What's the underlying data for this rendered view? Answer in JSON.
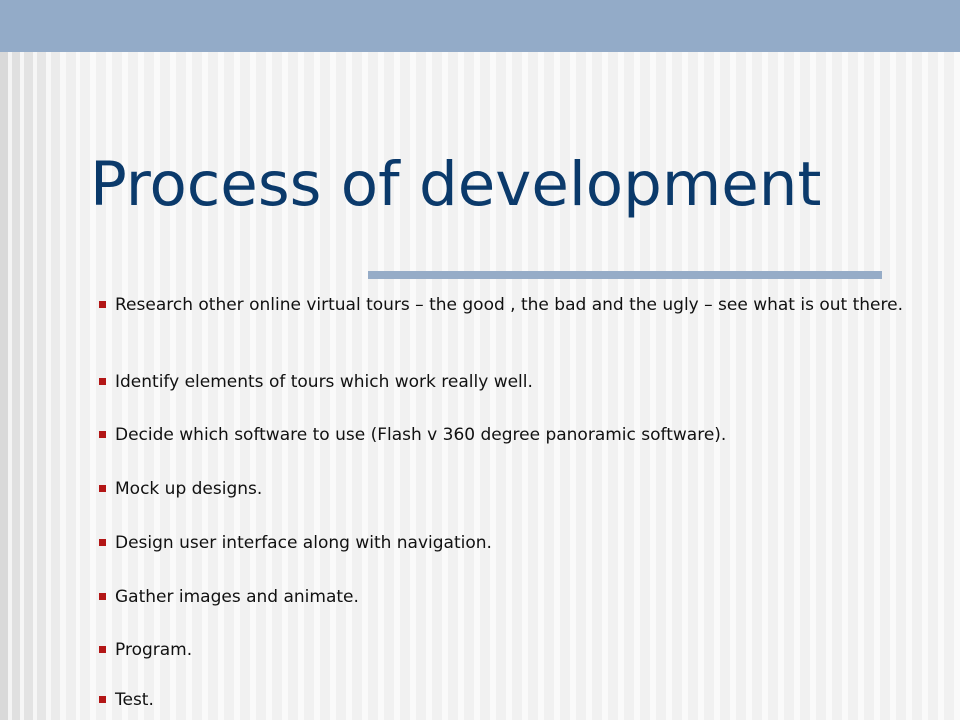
{
  "slide": {
    "title": "Process of development",
    "bullets": [
      {
        "text": "Research other online virtual tours – the good , the bad and the ugly – see what is out there."
      },
      {
        "text": "Identify elements of tours which work really well."
      },
      {
        "text": "Decide which software to use (Flash v 360 degree panoramic software)."
      },
      {
        "text": "Mock up designs."
      },
      {
        "text": "Design user interface along with navigation."
      },
      {
        "text": "Gather images and animate."
      },
      {
        "text": "Program."
      },
      {
        "text": "Test."
      }
    ]
  },
  "colors": {
    "title": "#0b3a6b",
    "accent_band": "#93abc8",
    "bullet": "#b31616"
  }
}
